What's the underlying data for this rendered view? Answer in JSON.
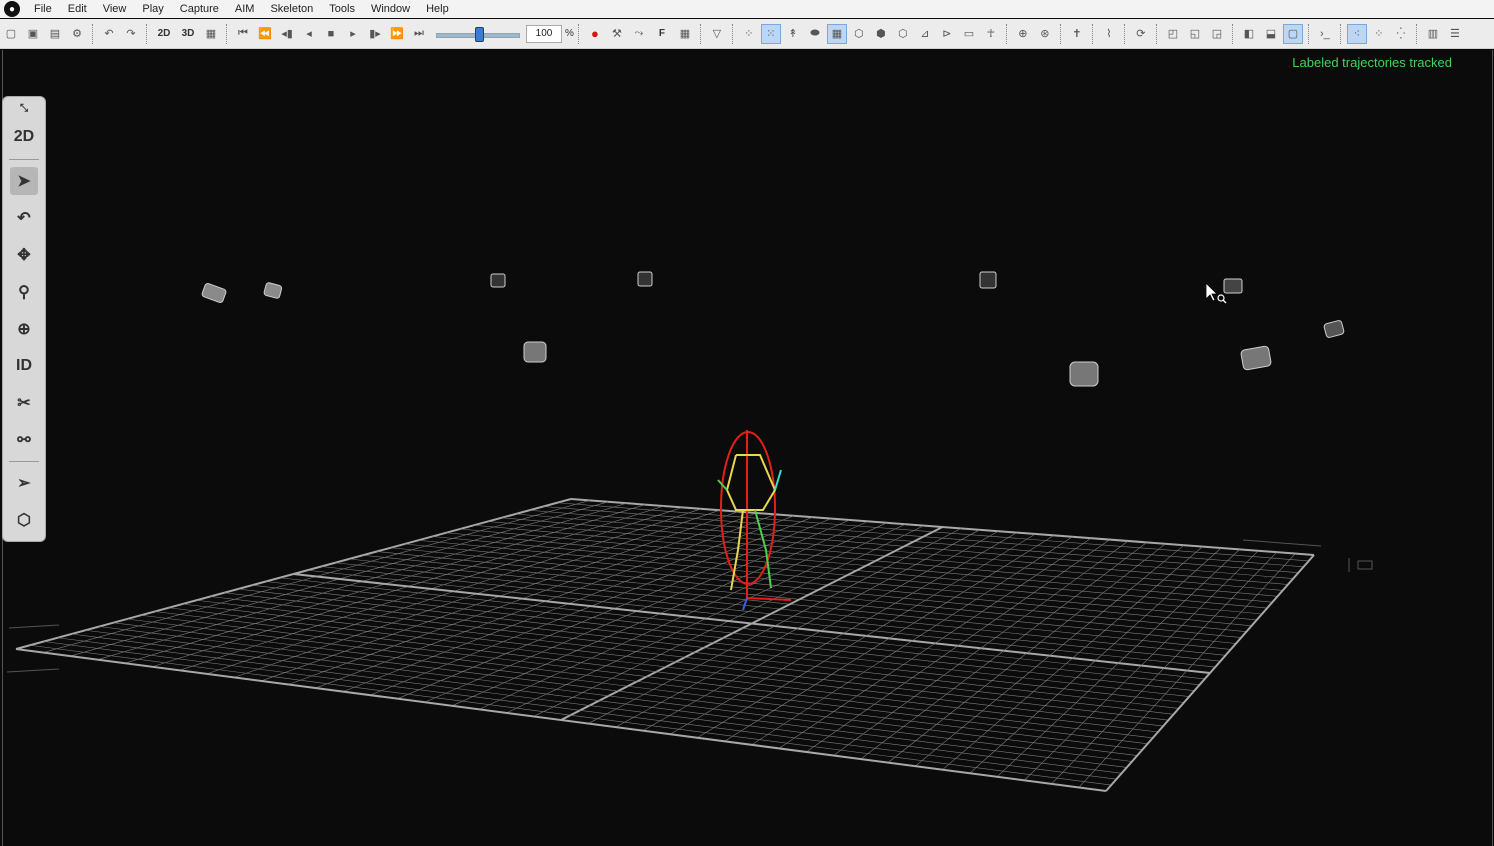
{
  "app": {
    "logo": "vicon-logo"
  },
  "menu": [
    "File",
    "Edit",
    "View",
    "Play",
    "Capture",
    "AIM",
    "Skeleton",
    "Tools",
    "Window",
    "Help"
  ],
  "toolbar": {
    "btn_2d": "2D",
    "btn_3d": "3D",
    "playback_speed": "100",
    "playback_speed_unit": "%",
    "playback_speed_fraction": 0.5,
    "btn_f": "F"
  },
  "viewport": {
    "status_message": "Labeled trajectories tracked",
    "status_color": "#42d35a"
  },
  "sidebar": {
    "btn_2d": "2D",
    "btn_id": "ID"
  },
  "colors": {
    "grid_line": "#7d7d7d",
    "subject_red": "#e0201a",
    "bone_yellow": "#e8d84a",
    "marker_cyan": "#3fd9d2",
    "marker_green": "#4cd04c"
  }
}
